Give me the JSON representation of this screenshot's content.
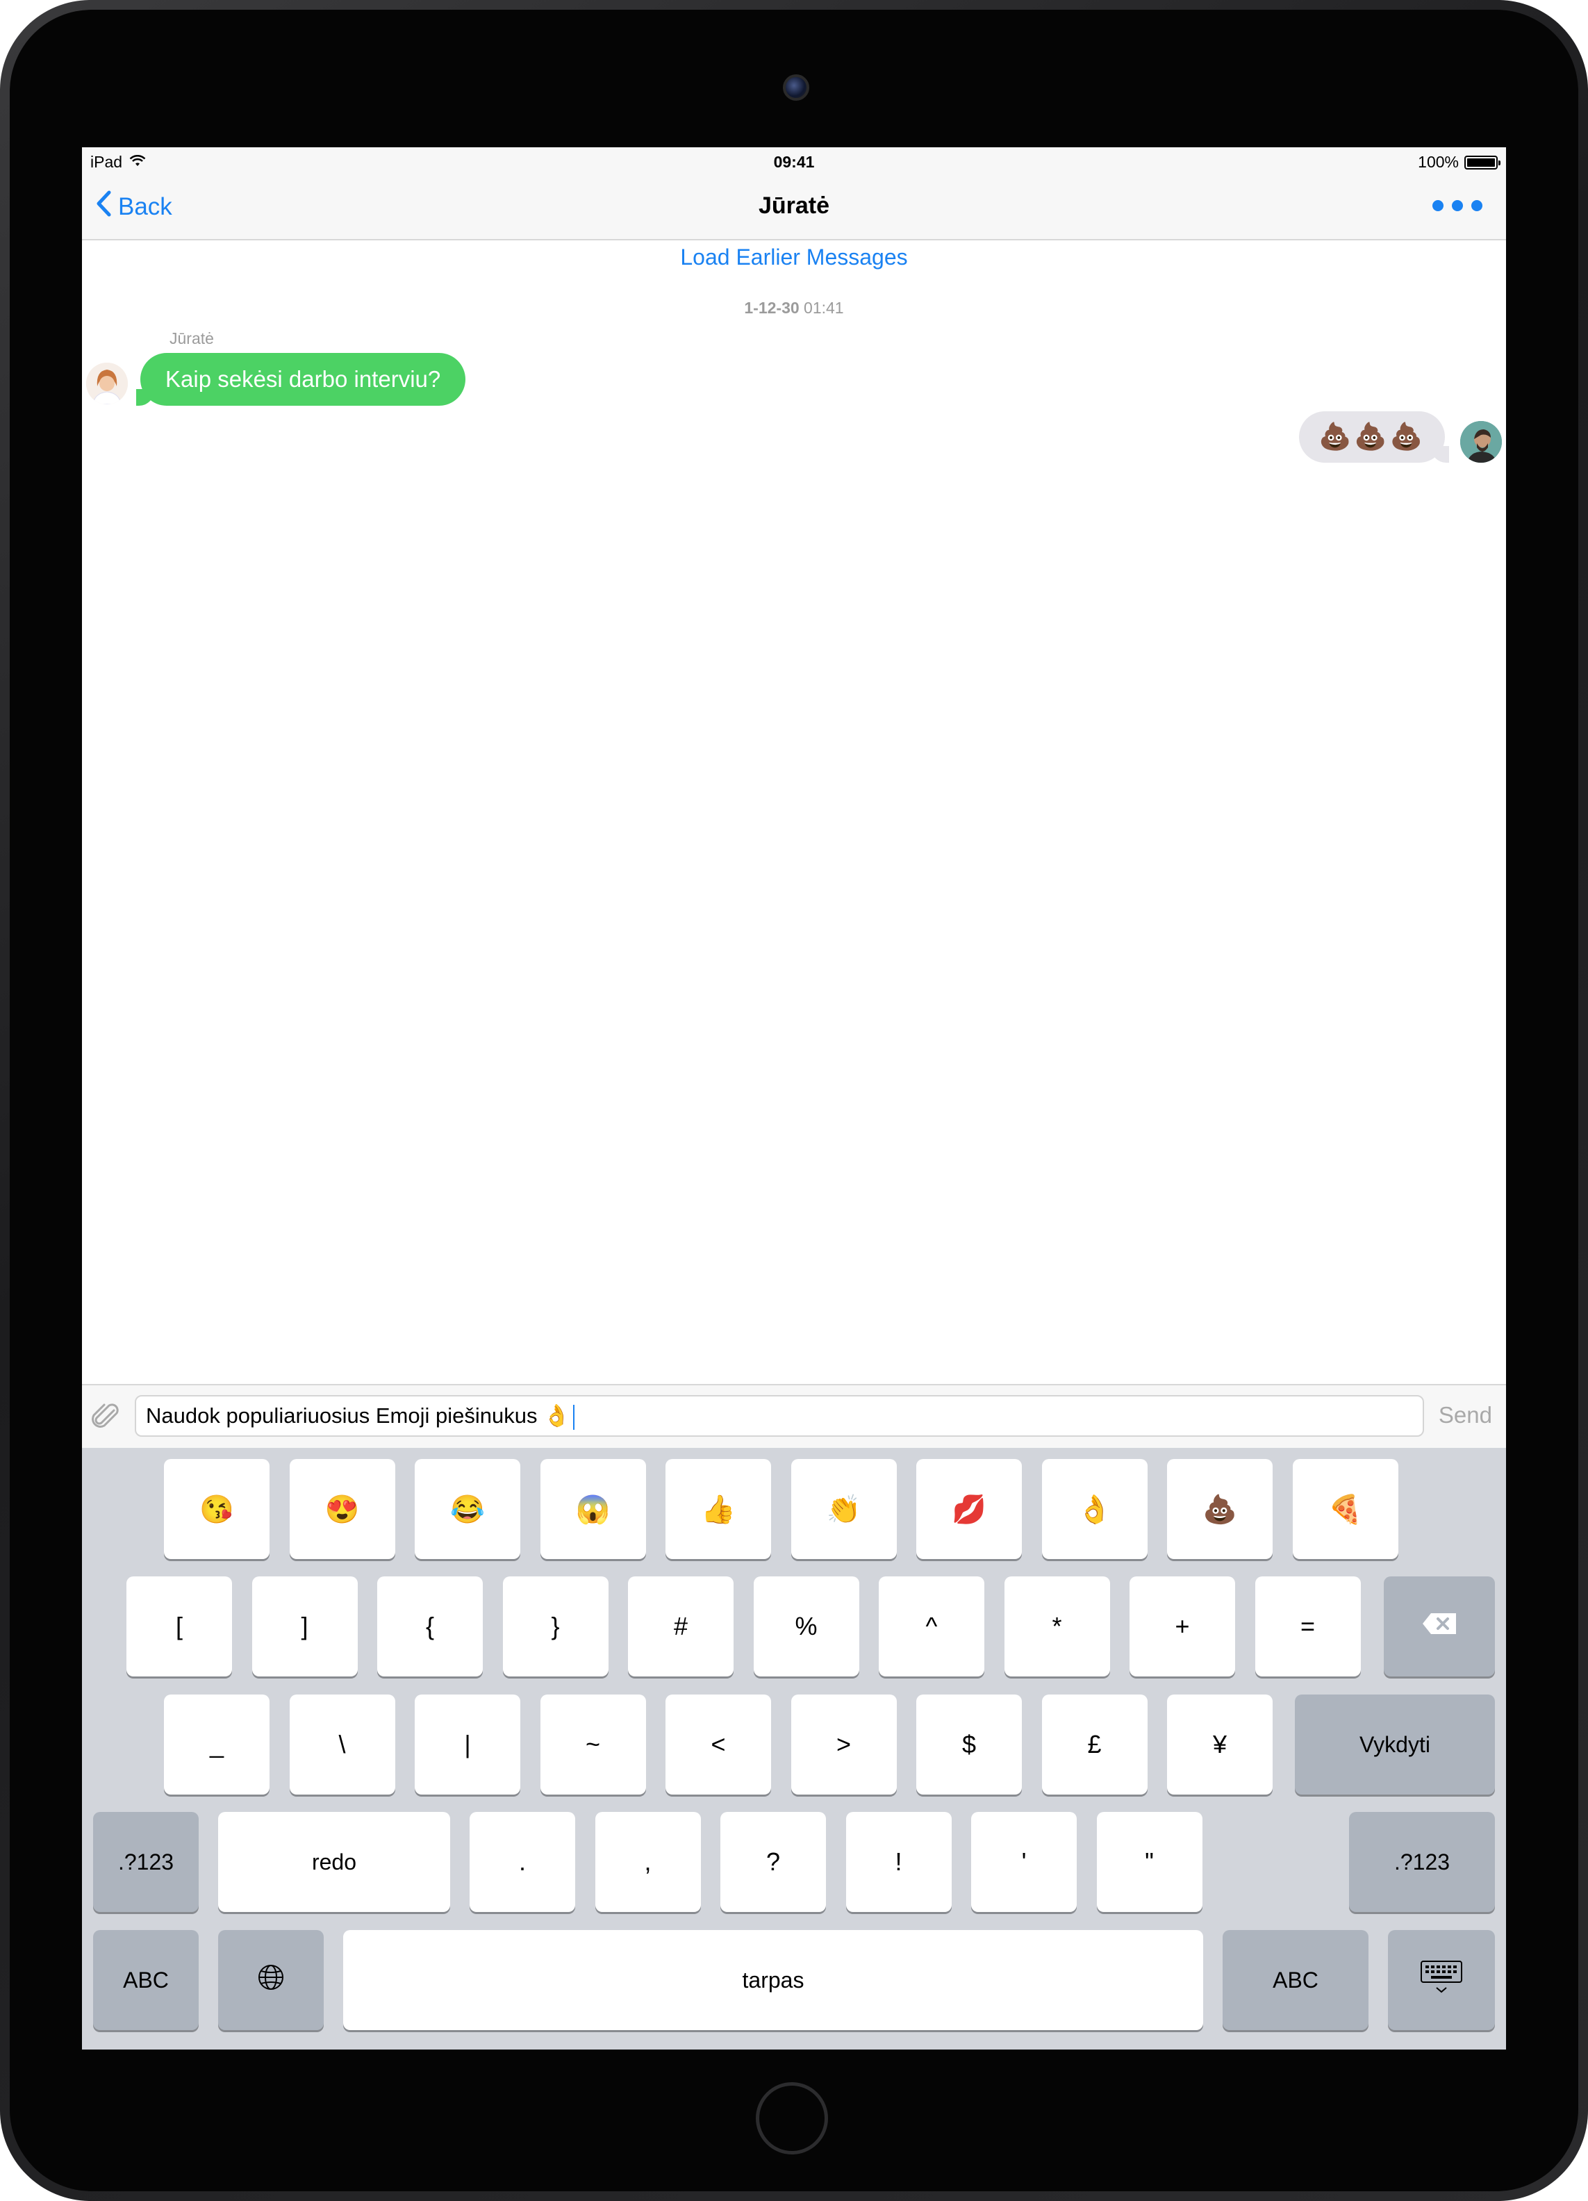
{
  "status_bar": {
    "device": "iPad",
    "time": "09:41",
    "battery": "100%"
  },
  "nav": {
    "back_label": "Back",
    "title": "Jūratė"
  },
  "conversation": {
    "load_earlier": "Load Earlier Messages",
    "date_part": "1-12-30",
    "time_part": "01:41",
    "incoming_sender": "Jūratė",
    "incoming_text": "Kaip sekėsi darbo interviu?",
    "outgoing_text": "💩💩💩"
  },
  "composer": {
    "input_value": "Naudok populiariuosius Emoji piešinukus 👌",
    "send_label": "Send"
  },
  "keyboard": {
    "emoji_row": [
      "😘",
      "😍",
      "😂",
      "😱",
      "👍",
      "👏",
      "💋",
      "👌",
      "💩",
      "🍕"
    ],
    "row1": [
      "[",
      "]",
      "{",
      "}",
      "#",
      "%",
      "^",
      "*",
      "+",
      "="
    ],
    "row2": [
      "_",
      "\\",
      "|",
      "~",
      "<",
      ">",
      "$",
      "£",
      "¥"
    ],
    "return_label": "Vykdyti",
    "row3_left": ".?123",
    "redo_label": "redo",
    "row3": [
      ".",
      ",",
      "?",
      "!",
      "'",
      "\""
    ],
    "row3_right": ".?123",
    "abc_left": "ABC",
    "space_label": "tarpas",
    "abc_right": "ABC"
  },
  "colors": {
    "accent": "#1a82f2",
    "incoming_bubble": "#4cd264",
    "outgoing_bubble": "#e6e5ea",
    "keyboard_bg": "#d2d5db"
  },
  "icons": [
    "wifi-icon",
    "battery-icon",
    "chevron-left-icon",
    "more-icon",
    "paperclip-icon",
    "backspace-icon",
    "globe-icon",
    "keyboard-dismiss-icon"
  ]
}
